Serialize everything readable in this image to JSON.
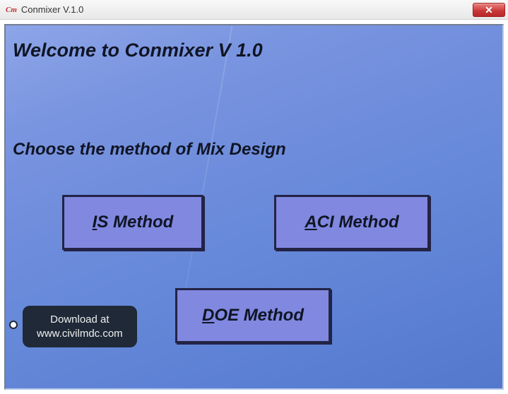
{
  "window": {
    "app_icon_text": "Cm",
    "title": "Conmixer V.1.0"
  },
  "main": {
    "welcome": "Welcome to Conmixer V 1.0",
    "choose": "Choose the method of Mix Design",
    "buttons": {
      "is": {
        "mnemonic": "I",
        "rest": "S Method"
      },
      "aci": {
        "mnemonic": "A",
        "rest": "CI Method"
      },
      "doe": {
        "mnemonic": "D",
        "rest": "OE Method"
      }
    }
  },
  "tooltip": {
    "line1": "Download at",
    "line2": "www.civilmdc.com"
  }
}
